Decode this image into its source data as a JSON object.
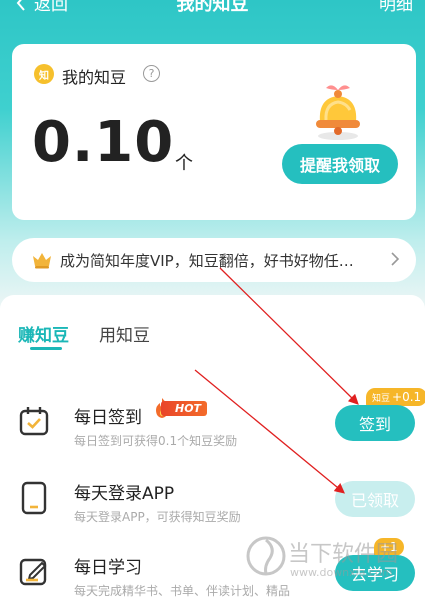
{
  "nav": {
    "back_label": "返回",
    "title": "我的知豆",
    "detail_label": "明细"
  },
  "balance_card": {
    "coin_glyph": "知",
    "label": "我的知豆",
    "help_glyph": "?",
    "amount": "0.10",
    "unit": "个",
    "remind_button": "提醒我领取"
  },
  "vip_banner": {
    "text": "成为简知年度VIP，知豆翻倍，好书好物任…"
  },
  "tabs": [
    {
      "label": "赚知豆",
      "active": true
    },
    {
      "label": "用知豆",
      "active": false
    }
  ],
  "tasks": [
    {
      "name": "每日签到",
      "hot": "HOT",
      "desc": "每日签到可获得0.1个知豆奖励",
      "button": "签到",
      "state": "active",
      "badge_prefix": "知豆",
      "badge_value": "+0.1"
    },
    {
      "name": "每天登录APP",
      "desc": "每天登录APP，可获得知豆奖励",
      "button": "已领取",
      "state": "done"
    },
    {
      "name": "每日学习",
      "desc": "每天完成精华书、书单、伴读计划、精品",
      "button": "去学习",
      "state": "active",
      "badge_value": "+1"
    }
  ],
  "watermark": {
    "text": "当下软件园",
    "url": "www.downxia.com"
  },
  "colors": {
    "teal": "#25bfbf",
    "teal_light": "#c8eeee",
    "gold": "#f6b629",
    "hot_red": "#e9452a",
    "annotation_red": "#e02020"
  }
}
